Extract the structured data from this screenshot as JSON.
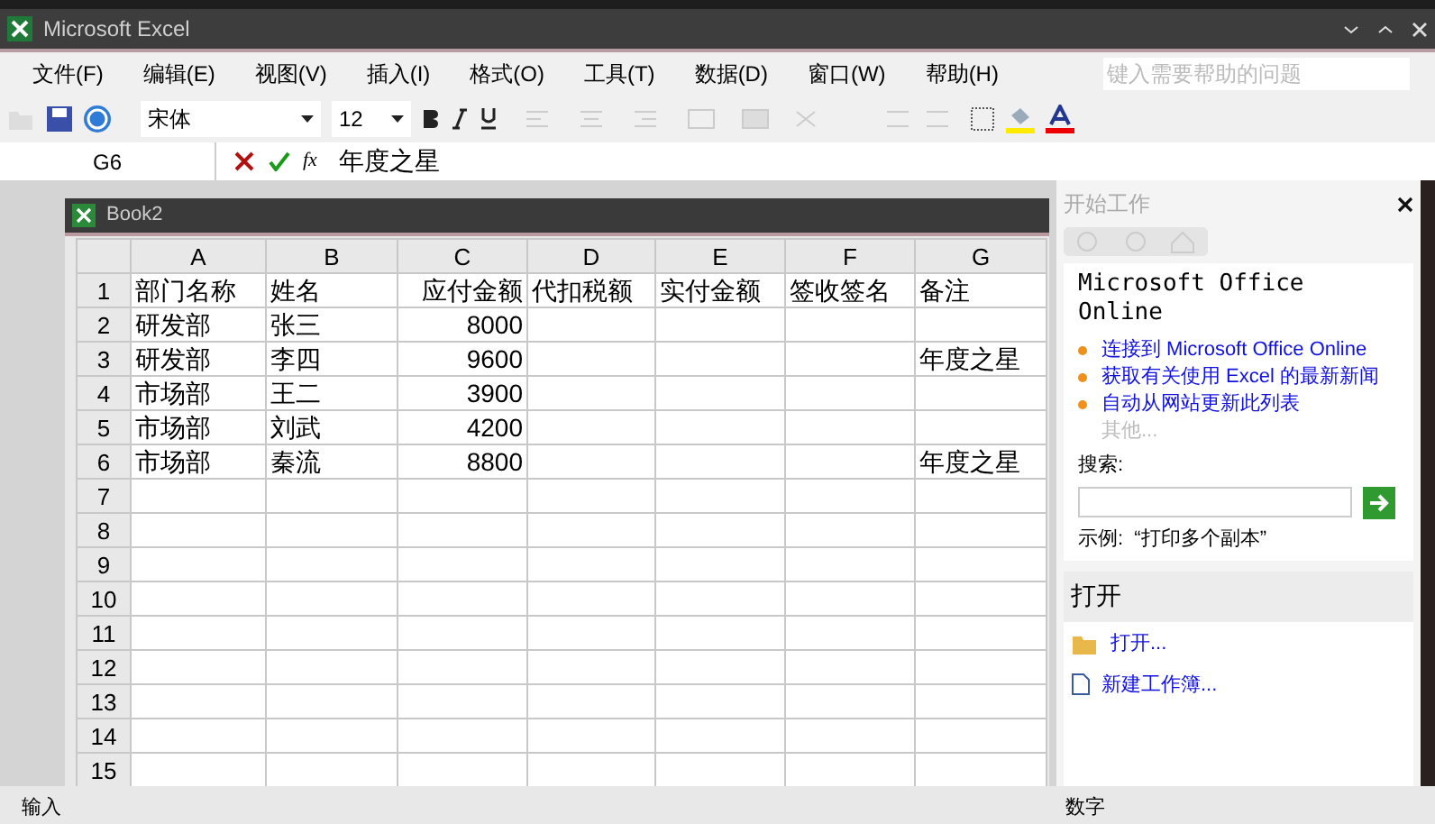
{
  "window": {
    "title": "Microsoft Excel"
  },
  "menu": [
    "文件(F)",
    "编辑(E)",
    "视图(V)",
    "插入(I)",
    "格式(O)",
    "工具(T)",
    "数据(D)",
    "窗口(W)",
    "帮助(H)"
  ],
  "help_search": {
    "placeholder": "键入需要帮助的问题"
  },
  "toolbar": {
    "font": "宋体",
    "size": "12"
  },
  "formula_bar": {
    "name_box": "G6",
    "fx": "fx",
    "value": "年度之星"
  },
  "workbook": {
    "title": "Book2",
    "columns": [
      {
        "label": "A",
        "kind": "text"
      },
      {
        "label": "B",
        "kind": "text"
      },
      {
        "label": "C",
        "kind": "number"
      },
      {
        "label": "D",
        "kind": "text"
      },
      {
        "label": "E",
        "kind": "text"
      },
      {
        "label": "F",
        "kind": "text"
      },
      {
        "label": "G",
        "kind": "text"
      }
    ],
    "rows": [
      {
        "label": "1",
        "cells": [
          "部门名称",
          "姓名",
          "应付金额",
          "代扣税额",
          "实付金额",
          "签收签名",
          "备注"
        ]
      },
      {
        "label": "2",
        "cells": [
          "研发部",
          "张三",
          "8000",
          "",
          "",
          "",
          ""
        ]
      },
      {
        "label": "3",
        "cells": [
          "研发部",
          "李四",
          "9600",
          "",
          "",
          "",
          "年度之星"
        ]
      },
      {
        "label": "4",
        "cells": [
          "市场部",
          "王二",
          "3900",
          "",
          "",
          "",
          ""
        ]
      },
      {
        "label": "5",
        "cells": [
          "市场部",
          "刘武",
          "4200",
          "",
          "",
          "",
          ""
        ]
      },
      {
        "label": "6",
        "cells": [
          "市场部",
          "秦流",
          "8800",
          "",
          "",
          "",
          "年度之星"
        ]
      },
      {
        "label": "7",
        "cells": []
      },
      {
        "label": "8",
        "cells": []
      },
      {
        "label": "9",
        "cells": []
      },
      {
        "label": "10",
        "cells": []
      },
      {
        "label": "11",
        "cells": []
      },
      {
        "label": "12",
        "cells": []
      },
      {
        "label": "13",
        "cells": []
      },
      {
        "label": "14",
        "cells": []
      },
      {
        "label": "15",
        "cells": []
      }
    ]
  },
  "task_pane": {
    "title": "开始工作",
    "section_title": "Microsoft Office Online",
    "links": [
      {
        "text": "连接到 Microsoft Office Online",
        "disabled": false
      },
      {
        "text": "获取有关使用 Excel 的最新新闻",
        "disabled": false
      },
      {
        "text": "自动从网站更新此列表",
        "disabled": false
      },
      {
        "text": "其他...",
        "disabled": true
      }
    ],
    "search_label": "搜索:",
    "example": "示例:  “打印多个副本”",
    "open_title": "打开",
    "open_items": [
      {
        "text": "打开...",
        "kind": "folder"
      },
      {
        "text": "新建工作簿...",
        "kind": "file"
      }
    ]
  },
  "status_bar": {
    "mode": "输入",
    "indicator": "数字"
  }
}
